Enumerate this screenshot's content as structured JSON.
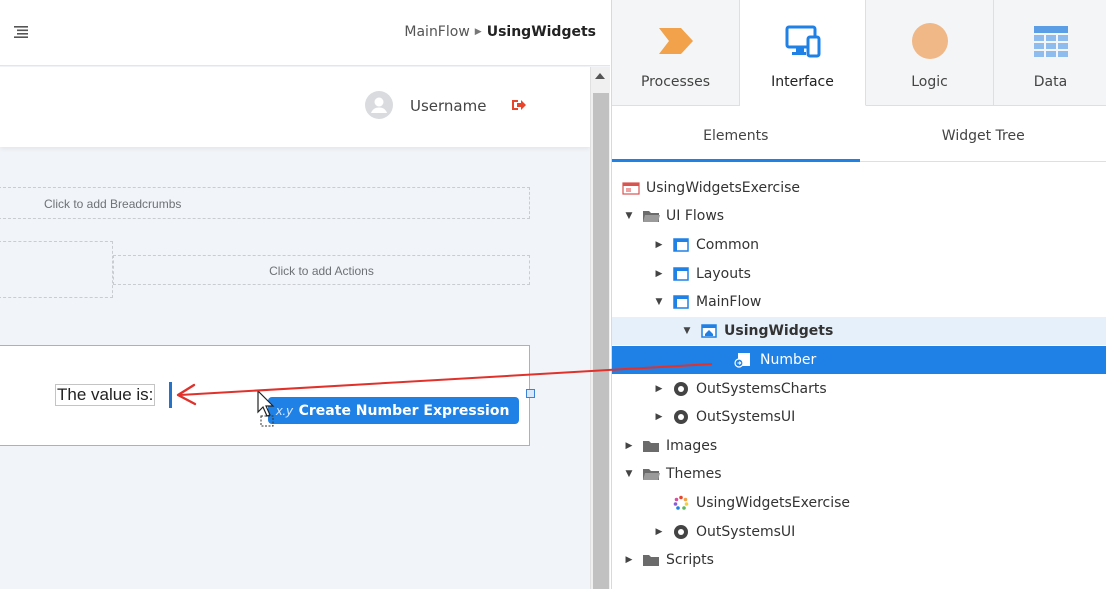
{
  "canvas": {
    "breadcrumb": {
      "flow": "MainFlow",
      "screen": "UsingWidgets"
    },
    "header": {
      "username": "Username"
    },
    "placeholders": {
      "breadcrumbs": "Click to add Breadcrumbs",
      "actions": "Click to add Actions"
    },
    "content": {
      "label": "The value is:"
    },
    "drag_tooltip": {
      "prefix": "x.y",
      "label": "Create Number Expression"
    }
  },
  "panel": {
    "layer_tabs": [
      {
        "label": "Processes",
        "icon": "processes-icon",
        "color": "#f1a24a"
      },
      {
        "label": "Interface",
        "icon": "interface-icon",
        "color": "#1f80e6",
        "active": true
      },
      {
        "label": "Logic",
        "icon": "logic-icon",
        "color": "#f0b787"
      },
      {
        "label": "Data",
        "icon": "data-icon",
        "color": "#5b9ee6"
      }
    ],
    "sub_tabs": [
      {
        "label": "Elements",
        "active": true
      },
      {
        "label": "Widget Tree"
      }
    ],
    "tree": [
      {
        "label": "UsingWidgetsExercise",
        "icon": "module-icon"
      },
      {
        "label": "UI Flows",
        "icon": "folder-open-icon",
        "expanded": true
      },
      {
        "label": "Common",
        "icon": "flow-icon"
      },
      {
        "label": "Layouts",
        "icon": "flow-icon"
      },
      {
        "label": "MainFlow",
        "icon": "flow-icon",
        "expanded": true
      },
      {
        "label": "UsingWidgets",
        "icon": "screen-icon",
        "expanded": true
      },
      {
        "label": "Number",
        "icon": "input-parameter-icon",
        "selected": true
      },
      {
        "label": "OutSystemsCharts",
        "icon": "reference-icon"
      },
      {
        "label": "OutSystemsUI",
        "icon": "reference-icon"
      },
      {
        "label": "Images",
        "icon": "folder-icon"
      },
      {
        "label": "Themes",
        "icon": "folder-open-icon",
        "expanded": true
      },
      {
        "label": "UsingWidgetsExercise",
        "icon": "theme-icon"
      },
      {
        "label": "OutSystemsUI",
        "icon": "reference-icon"
      },
      {
        "label": "Scripts",
        "icon": "folder-icon"
      }
    ]
  },
  "colors": {
    "accent": "#1f80e6",
    "drag_arrow": "#e0312b",
    "logout": "#e8462c"
  }
}
